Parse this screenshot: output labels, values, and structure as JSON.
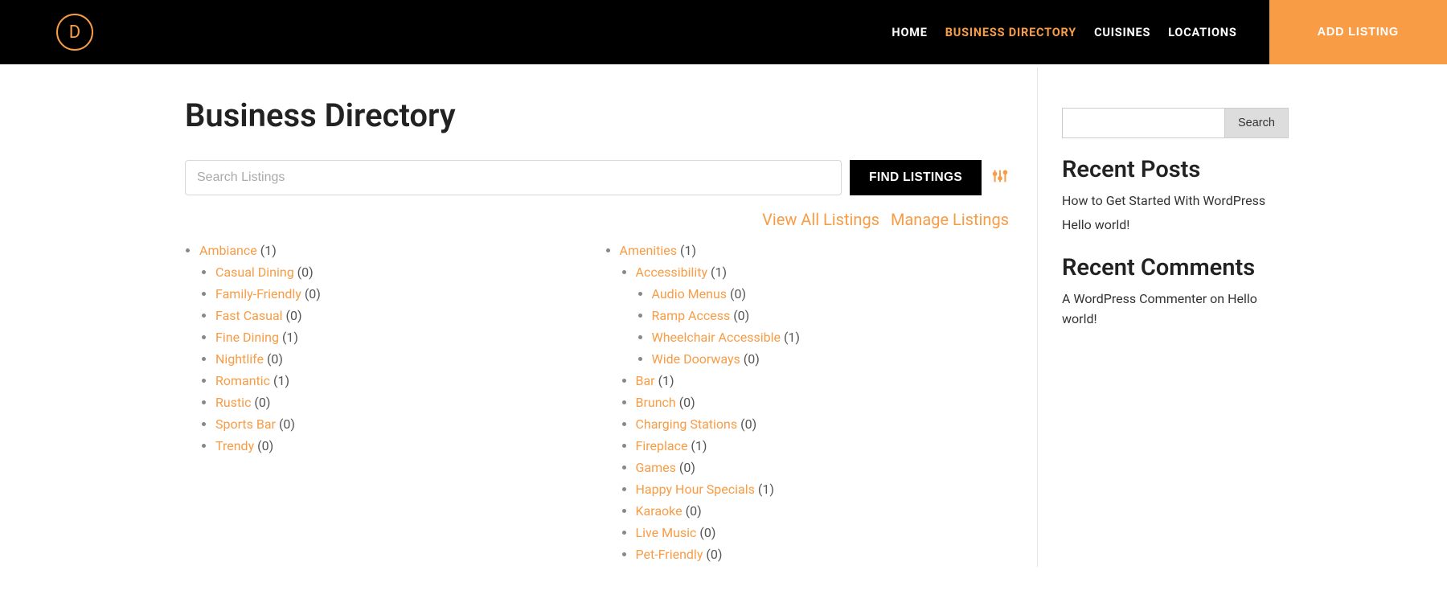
{
  "header": {
    "logo_letter": "D",
    "nav": [
      {
        "label": "Home",
        "active": false
      },
      {
        "label": "Business Directory",
        "active": true
      },
      {
        "label": "Cuisines",
        "active": false
      },
      {
        "label": "Locations",
        "active": false
      }
    ],
    "add_listing_label": "Add Listing"
  },
  "main": {
    "title": "Business Directory",
    "search_placeholder": "Search Listings",
    "find_label": "Find Listings",
    "view_all_label": "View All Listings",
    "manage_label": "Manage Listings",
    "categories_col1": [
      {
        "label": "Ambiance",
        "count": "(1)",
        "children": [
          {
            "label": "Casual Dining",
            "count": "(0)"
          },
          {
            "label": "Family-Friendly",
            "count": "(0)"
          },
          {
            "label": "Fast Casual",
            "count": "(0)"
          },
          {
            "label": "Fine Dining",
            "count": "(1)"
          },
          {
            "label": "Nightlife",
            "count": "(0)"
          },
          {
            "label": "Romantic",
            "count": "(1)"
          },
          {
            "label": "Rustic",
            "count": "(0)"
          },
          {
            "label": "Sports Bar",
            "count": "(0)"
          },
          {
            "label": "Trendy",
            "count": "(0)"
          }
        ]
      }
    ],
    "categories_col2": [
      {
        "label": "Amenities",
        "count": "(1)",
        "children": [
          {
            "label": "Accessibility",
            "count": "(1)",
            "children": [
              {
                "label": "Audio Menus",
                "count": "(0)"
              },
              {
                "label": "Ramp Access",
                "count": "(0)"
              },
              {
                "label": "Wheelchair Accessible",
                "count": "(1)"
              },
              {
                "label": "Wide Doorways",
                "count": "(0)"
              }
            ]
          },
          {
            "label": "Bar",
            "count": "(1)"
          },
          {
            "label": "Brunch",
            "count": "(0)"
          },
          {
            "label": "Charging Stations",
            "count": "(0)"
          },
          {
            "label": "Fireplace",
            "count": "(1)"
          },
          {
            "label": "Games",
            "count": "(0)"
          },
          {
            "label": "Happy Hour Specials",
            "count": "(1)"
          },
          {
            "label": "Karaoke",
            "count": "(0)"
          },
          {
            "label": "Live Music",
            "count": "(0)"
          },
          {
            "label": "Pet-Friendly",
            "count": "(0)"
          }
        ]
      }
    ]
  },
  "sidebar": {
    "search_button": "Search",
    "recent_posts_title": "Recent Posts",
    "recent_posts": [
      "How to Get Started With WordPress",
      "Hello world!"
    ],
    "recent_comments_title": "Recent Comments",
    "comment_author": "A WordPress Commenter",
    "comment_on": " on ",
    "comment_post": "Hello world!"
  }
}
